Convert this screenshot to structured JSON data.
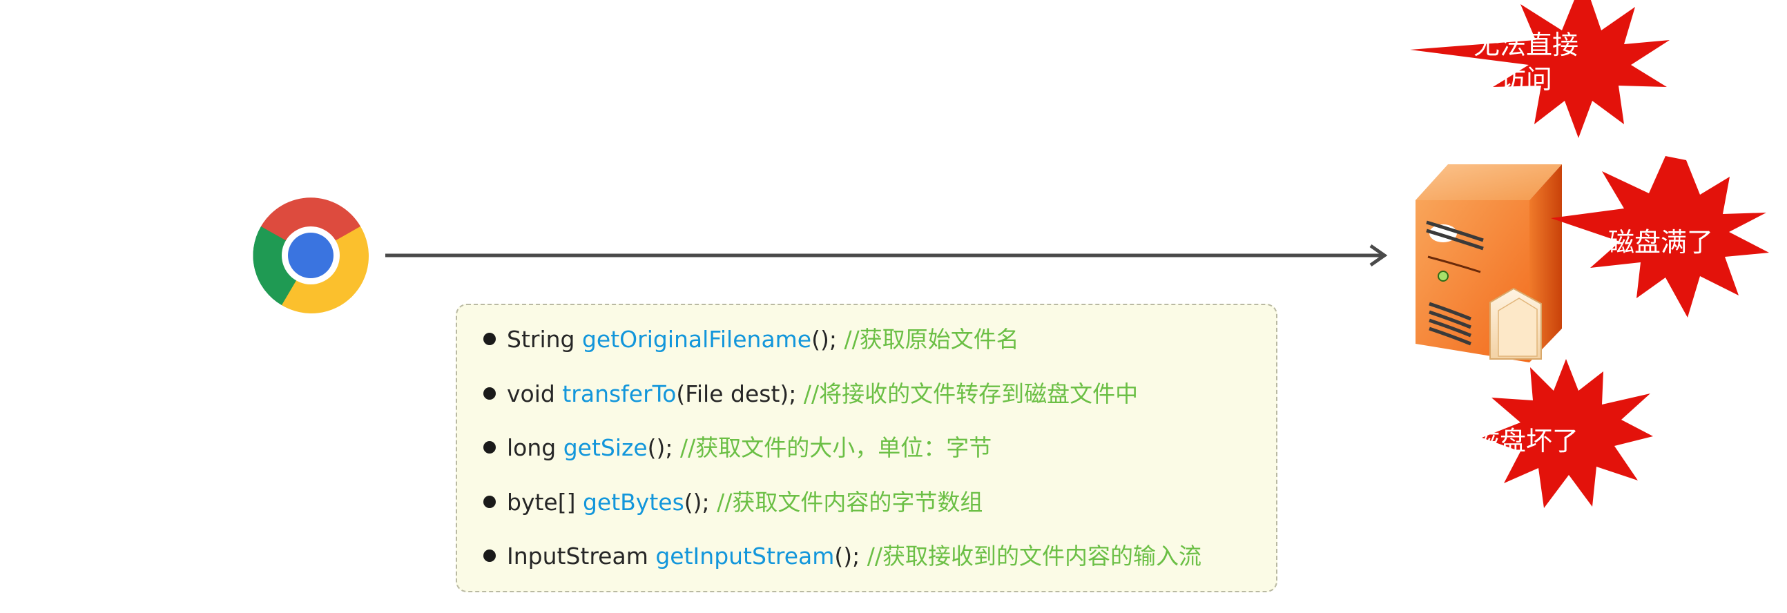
{
  "diagram": {
    "methods": [
      {
        "ret": "String",
        "name": "getOriginalFilename",
        "args": "();",
        "comment": "//获取原始文件名"
      },
      {
        "ret": "void",
        "name": "transferTo",
        "args": "(File dest);",
        "comment": "//将接收的文件转存到磁盘文件中"
      },
      {
        "ret": "long",
        "name": "getSize",
        "args": "();",
        "comment": "//获取文件的大小，单位：字节"
      },
      {
        "ret": "byte[]",
        "name": "getBytes",
        "args": "();",
        "comment": "//获取文件内容的字节数组"
      },
      {
        "ret": "InputStream",
        "name": "getInputStream",
        "args": "();",
        "comment": "//获取接收到的文件内容的输入流"
      }
    ],
    "problems": {
      "no_access": {
        "line1": "无法直接",
        "line2": "访问"
      },
      "disk_full": "磁盘满了",
      "disk_broken": "磁盘坏了"
    },
    "colors": {
      "method_name": "#1296db",
      "comment": "#6bbf45",
      "burst": "#e3120b",
      "server_orange": "#f26a1b",
      "arrow": "#4a4a4a"
    },
    "icons": [
      "chrome-browser-icon",
      "server-icon",
      "folder-icon"
    ]
  }
}
